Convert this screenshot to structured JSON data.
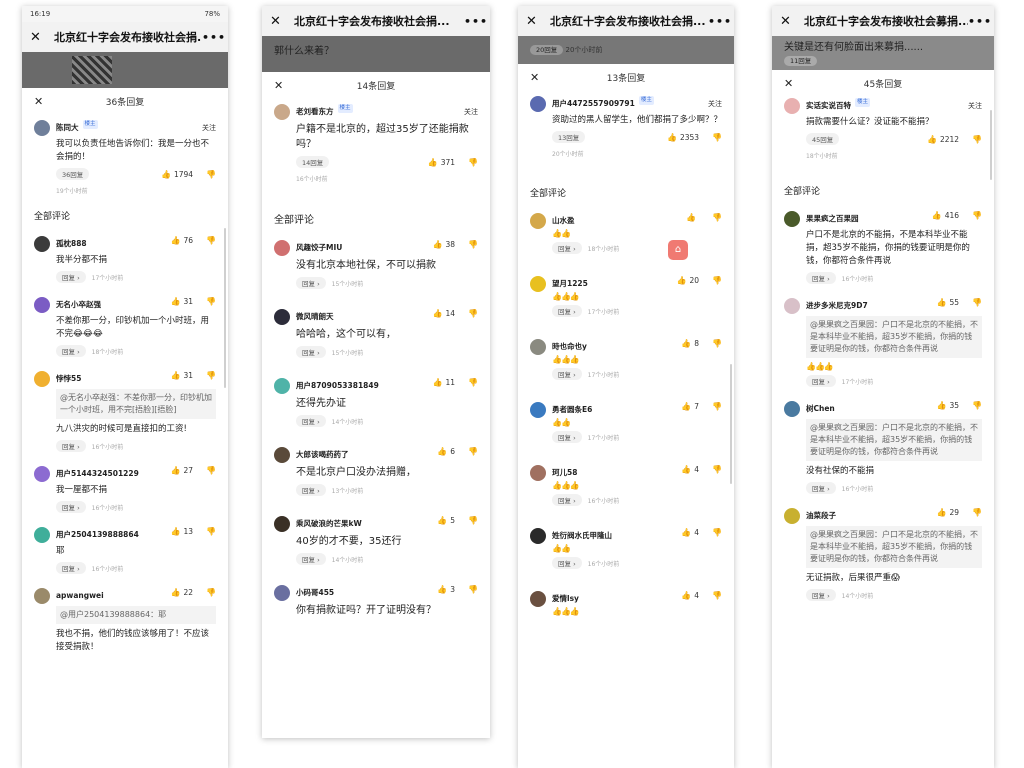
{
  "panel1": {
    "statusbar": {
      "time": "16:19",
      "right": "78%"
    },
    "title": "北京红十字会发布接收社会捐...",
    "sheet_count": "36条回复",
    "main": {
      "user": "陈同大",
      "badge": "楼主",
      "follow": "关注",
      "text": "我可以负责任地告诉你们：我是一分也不会捐的！",
      "replies": "36回复",
      "likes": "1794",
      "time": "19个小时前"
    },
    "section": "全部评论",
    "comments": [
      {
        "user": "孤枕888",
        "likes": "76",
        "text": "我半分都不捐",
        "time": "17个小时前",
        "quote": "",
        "emoji": "",
        "extra": ""
      },
      {
        "user": "无名小卒赵强",
        "likes": "31",
        "text": "不差你那一分，印钞机加一个小时班，用不完😂😂😂",
        "time": "18个小时前",
        "quote": "",
        "emoji": "",
        "extra": ""
      },
      {
        "user": "悖悖55",
        "likes": "31",
        "text": "九八洪灾的时候可是直接扣的工资!",
        "time": "16个小时前",
        "quote": "@无名小卒赵强：不差你那一分，印钞机加一个小时班，用不完[捂脸][捂脸]",
        "emoji": "",
        "extra": ""
      },
      {
        "user": "用户5144324501229",
        "likes": "27",
        "text": "我一厘都不捐",
        "time": "16个小时前",
        "quote": "",
        "emoji": "",
        "extra": ""
      },
      {
        "user": "用户2504139888864",
        "likes": "13",
        "text": "耶",
        "time": "16个小时前",
        "quote": "",
        "emoji": "",
        "extra": ""
      },
      {
        "user": "apwangwei",
        "likes": "22",
        "text": "我也不捐，他们的钱应该够用了！不应该接受捐款！",
        "time": "",
        "quote": "@用户2504139888864：耶",
        "emoji": "",
        "extra": ""
      }
    ]
  },
  "panel2": {
    "title": "北京红十字会发布接收社会捐...",
    "dim_text": "郭什么来着？",
    "sheet_count": "14条回复",
    "main": {
      "user": "老刘看东方",
      "badge": "楼主",
      "follow": "关注",
      "text": "户籍不是北京的，超过35岁了还能捐款吗？",
      "replies": "14回复",
      "likes": "371",
      "time": "16个小时前"
    },
    "section": "全部评论",
    "comments": [
      {
        "user": "风趣饺子MIU",
        "likes": "38",
        "text": "没有北京本地社保，不可以捐款",
        "time": "15个小时前"
      },
      {
        "user": "微风晴朗天",
        "likes": "14",
        "text": "哈哈哈，这个可以有，",
        "time": "15个小时前"
      },
      {
        "user": "用户8709053381849",
        "likes": "11",
        "text": "还得先办证",
        "time": "14个小时前"
      },
      {
        "user": "大郎该喝药药了",
        "likes": "6",
        "text": "不是北京户口没办法捐赠，",
        "time": "13个小时前"
      },
      {
        "user": "乘风破浪的芒果kW",
        "likes": "5",
        "text": "40岁的才不要，35还行",
        "time": "14个小时前"
      },
      {
        "user": "小码哥455",
        "likes": "3",
        "text": "你有捐款证吗？开了证明没有？",
        "time": ""
      }
    ]
  },
  "panel3": {
    "title": "北京红十字会发布接收社会捐...",
    "dim_pill": "20回复",
    "dim_time": "20个小时前",
    "sheet_count": "13条回复",
    "main": {
      "user": "用户4472557909791",
      "badge": "楼主",
      "follow": "关注",
      "text": "资助过的黑人留学生，他们都捐了多少啊？？",
      "replies": "13回复",
      "likes": "2353",
      "time": "20个小时前"
    },
    "section": "全部评论",
    "comments": [
      {
        "user": "山水盈",
        "likes": "",
        "emoji": "👍👍",
        "time": "18个小时前"
      },
      {
        "user": "望月1225",
        "likes": "20",
        "emoji": "👍👍👍",
        "time": "17个小时前"
      },
      {
        "user": "時也命也y",
        "likes": "8",
        "emoji": "👍👍👍",
        "time": "17个小时前"
      },
      {
        "user": "勇者圆条E6",
        "likes": "7",
        "emoji": "👍👍",
        "time": "17个小时前"
      },
      {
        "user": "珂儿58",
        "likes": "4",
        "emoji": "👍👍👍",
        "time": "16个小时前"
      },
      {
        "user": "姓衍阀水氏甲隆山",
        "likes": "4",
        "emoji": "👍👍",
        "time": "16个小时前"
      },
      {
        "user": "爱情lsy",
        "likes": "4",
        "emoji": "👍👍👍",
        "time": ""
      }
    ]
  },
  "panel4": {
    "title": "北京红十字会发布接收社会募捐...",
    "dim_text": "关键是还有何脸面出来募捐......",
    "dim_pill": "11回复",
    "sheet_count": "45条回复",
    "main": {
      "user": "实话实说百特",
      "badge": "楼主",
      "follow": "关注",
      "text": "捐款需要什么证？没证能不能捐？",
      "replies": "45回复",
      "likes": "2212",
      "time": "18个小时前"
    },
    "section": "全部评论",
    "comments": [
      {
        "user": "果果疯之百果园",
        "likes": "416",
        "quote": "",
        "text": "户口不是北京的不能捐，不是本科毕业不能捐，超35岁不能捐，你捐的钱要证明是你的钱，你都符合条件再说",
        "emoji": "",
        "time": "16个小时前"
      },
      {
        "user": "进步多米尼克9D7",
        "likes": "55",
        "quote": "@果果疯之百果园：户口不是北京的不能捐，不是本科毕业不能捐，超35岁不能捐，你捐的钱要证明是你的钱，你都符合条件再说",
        "text": "",
        "emoji": "👍👍👍",
        "time": "17个小时前"
      },
      {
        "user": "树Chen",
        "likes": "35",
        "quote": "@果果疯之百果园：户口不是北京的不能捐，不是本科毕业不能捐，超35岁不能捐，你捐的钱要证明是你的钱，你都符合条件再说",
        "text": "没有社保的不能捐",
        "emoji": "",
        "time": "16个小时前"
      },
      {
        "user": "油菜段子",
        "likes": "29",
        "quote": "@果果疯之百果园：户口不是北京的不能捐，不是本科毕业不能捐，超35岁不能捐，你捐的钱要证明是你的钱，你都符合条件再说",
        "text": "无证捐款，后果很严重😱",
        "emoji": "",
        "time": "14个小时前"
      }
    ]
  },
  "labels": {
    "reply": "回复 ›",
    "close": "✕",
    "more": "•••"
  }
}
